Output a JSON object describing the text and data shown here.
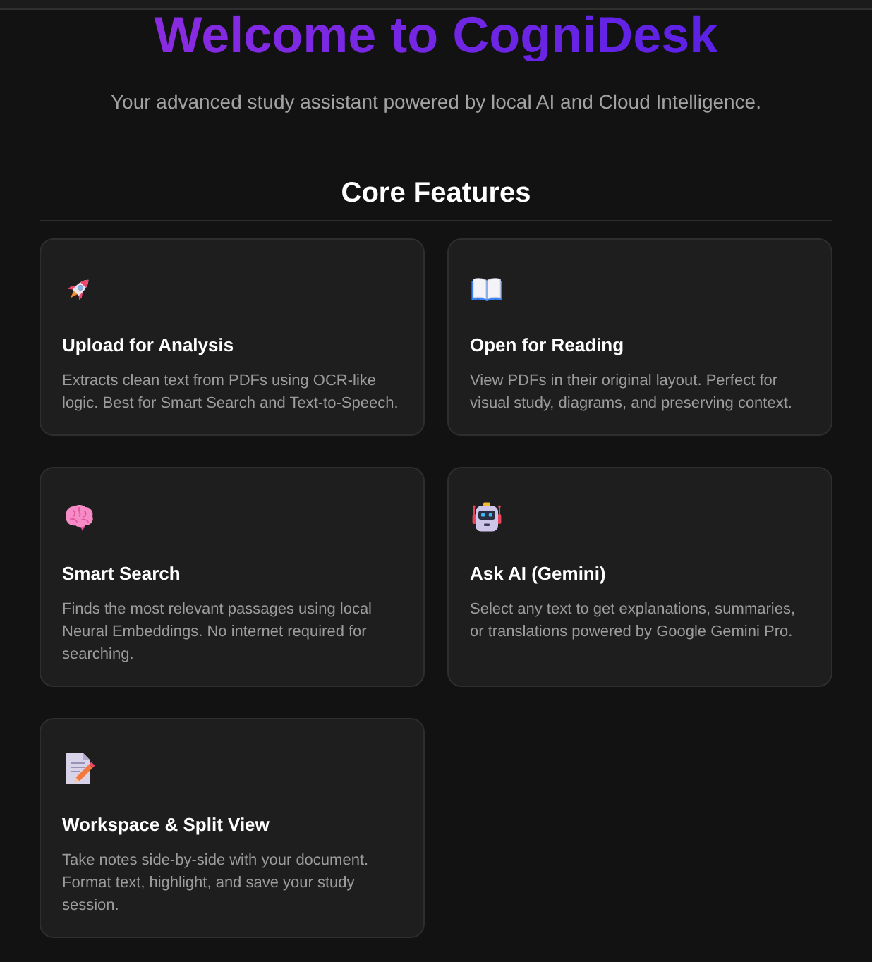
{
  "header": {
    "title": "Welcome to CogniDesk",
    "subtitle": "Your advanced study assistant powered by local AI and Cloud Intelligence."
  },
  "features": {
    "heading": "Core Features",
    "cards": [
      {
        "title": "Upload for Analysis",
        "description": "Extracts clean text from PDFs using OCR-like logic. Best for Smart Search and Text-to-Speech."
      },
      {
        "title": "Open for Reading",
        "description": "View PDFs in their original layout. Perfect for visual study, diagrams, and preserving context."
      },
      {
        "title": "Smart Search",
        "description": "Finds the most relevant passages using local Neural Embeddings. No internet required for searching."
      },
      {
        "title": "Ask AI (Gemini)",
        "description": "Select any text to get explanations, summaries, or translations powered by Google Gemini Pro."
      },
      {
        "title": "Workspace & Split View",
        "description": "Take notes side-by-side with your document. Format text, highlight, and save your study session."
      }
    ]
  }
}
